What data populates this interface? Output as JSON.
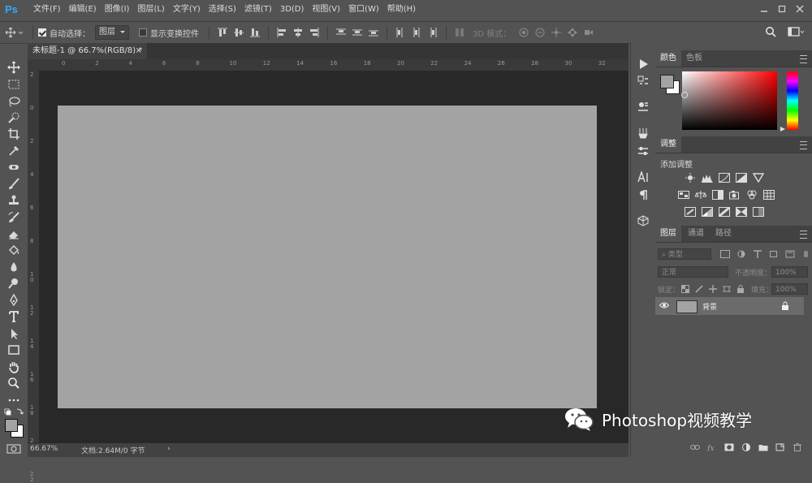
{
  "app": {
    "logo": "Ps"
  },
  "menu": [
    "文件(F)",
    "编辑(E)",
    "图像(I)",
    "图层(L)",
    "文字(Y)",
    "选择(S)",
    "滤镜(T)",
    "3D(D)",
    "视图(V)",
    "窗口(W)",
    "帮助(H)"
  ],
  "window_controls": [
    "minimize-icon",
    "restore-icon",
    "close-icon"
  ],
  "options_bar": {
    "auto_select_label": "自动选择：",
    "auto_select_checked": true,
    "auto_select_value": "图层",
    "show_transform_label": "显示变换控件",
    "show_transform_checked": false,
    "mode_3d_label": "3D 模式："
  },
  "document": {
    "tab_title": "未标题-1 @ 66.7%(RGB/8) *",
    "zoom": "66.67%",
    "info": "文档:2.64M/0 字节",
    "canvas_color": "#a3a3a3",
    "ruler_top": [
      "0",
      "2",
      "4",
      "6",
      "8",
      "10",
      "12",
      "14",
      "16",
      "18",
      "20",
      "22",
      "24",
      "26",
      "28",
      "30",
      "32"
    ],
    "ruler_left": [
      "2",
      "0",
      "2",
      "4",
      "6",
      "8",
      "1\n0",
      "1\n2",
      "1\n4",
      "1\n6",
      "1\n8",
      "2\n0",
      "2\n2"
    ]
  },
  "panels": {
    "color": {
      "tabs": [
        "颜色",
        "色板"
      ],
      "fg": "#a3a3a3",
      "bg": "#ffffff"
    },
    "adjustments": {
      "tabs": [
        "调整"
      ],
      "add_label": "添加调整"
    },
    "layers": {
      "tabs": [
        "图层",
        "通道",
        "路径"
      ],
      "filter_placeholder": "类型",
      "blend_mode": "正常",
      "opacity_label": "不透明度：",
      "opacity_value": "100%",
      "lock_label": "锁定：",
      "fill_label": "填充：",
      "fill_value": "100%",
      "layer_name": "背景"
    }
  },
  "watermark": {
    "text": "Photoshop视频教学"
  }
}
